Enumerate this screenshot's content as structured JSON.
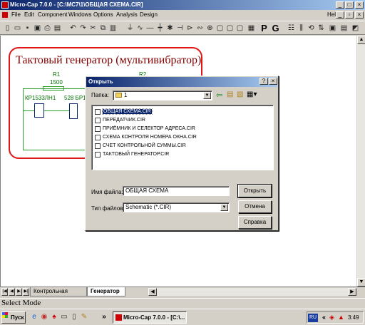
{
  "window": {
    "title": "Micro-Cap 7.0.0 - [C:\\MC7\\1\\ОБЩАЯ СХЕМА.CIR]",
    "controls": [
      "_",
      "□",
      "×"
    ]
  },
  "menu": {
    "items": [
      "File",
      "Edit",
      "Component",
      "Windows",
      "Options",
      "Analysis",
      "Design"
    ],
    "help": "Help"
  },
  "toolbar": {
    "probe_label": "P",
    "grid_label": "G"
  },
  "schematic": {
    "title": "Тактовый генератор (мультивибратор)",
    "r1_label": "R1",
    "r1_value": "1500",
    "r2_label": "R2",
    "chip1_label": "КР1533ЛН1",
    "chip2_label": "528 БР1"
  },
  "tabs": {
    "items": [
      "Контрольная сумма",
      "Генератор"
    ],
    "active": "Генератор"
  },
  "status": {
    "text": "Select Mode"
  },
  "taskbar": {
    "start_label": "Пуск",
    "task_label": "Micro-Cap 7.0.0 - [C:\\...",
    "lang": "RU",
    "time": "3:49"
  },
  "dialog": {
    "title": "Открыть",
    "folder_label": "Папка:",
    "folder_value": "1",
    "files": [
      "ОБЩАЯ СХЕМА.CIR",
      "ПЕРЕДАТЧИК.CIR",
      "ПРИЁМНИК И СЕЛЕКТОР АДРЕСА.CIR",
      "СХЕМА КОНТРОЛЯ НОМЕРА ОКНА.CIR",
      "СЧЕТ КОНТРОЛЬНОЙ СУММЫ.CIR",
      "ТАКТОВЫЙ ГЕНЕРАТОР.CIR"
    ],
    "selected_file": "ОБЩАЯ СХЕМА.CIR",
    "filename_label": "Имя файла:",
    "filename_value": "ОБЩАЯ СХЕМА",
    "filetype_label": "Тип файлов:",
    "filetype_value": "Schematic (*.CIR)",
    "open_button": "Открыть",
    "cancel_button": "Отмена",
    "help_button": "Справка"
  }
}
